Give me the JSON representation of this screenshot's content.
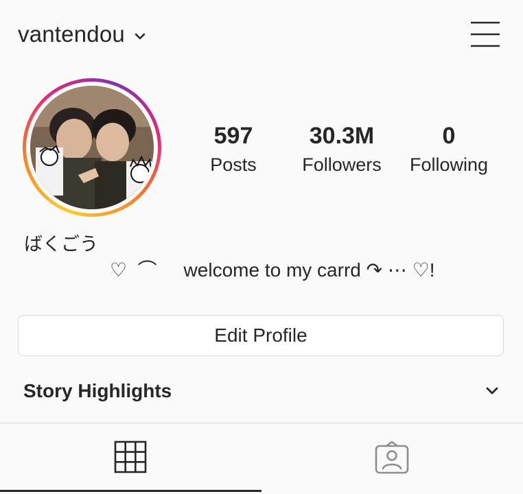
{
  "header": {
    "username": "vantendou",
    "dropdown_icon": "chevron-down-icon",
    "menu_icon": "hamburger-menu-icon"
  },
  "profile": {
    "avatar_icon": "profile-photo",
    "stats": {
      "posts": {
        "value": "597",
        "label": "Posts"
      },
      "followers": {
        "value": "30.3M",
        "label": "Followers"
      },
      "following": {
        "value": "0",
        "label": "Following"
      }
    },
    "display_name": "ばくごう",
    "bio": "♡  ⌒     welcome to my carrd ↷ ⋯ ♡!"
  },
  "actions": {
    "edit_profile_label": "Edit Profile"
  },
  "highlights": {
    "title": "Story Highlights",
    "toggle_icon": "chevron-down-icon"
  },
  "tabs": [
    {
      "name": "posts-grid",
      "icon": "grid-icon",
      "active": true
    },
    {
      "name": "tagged",
      "icon": "tagged-person-icon",
      "active": false
    }
  ],
  "colors": {
    "text": "#262626",
    "border": "#dbdbdb",
    "background": "#fafafa",
    "ring_gradient": [
      "#f9ce34",
      "#f58529",
      "#dd2a7b",
      "#8134af"
    ]
  }
}
